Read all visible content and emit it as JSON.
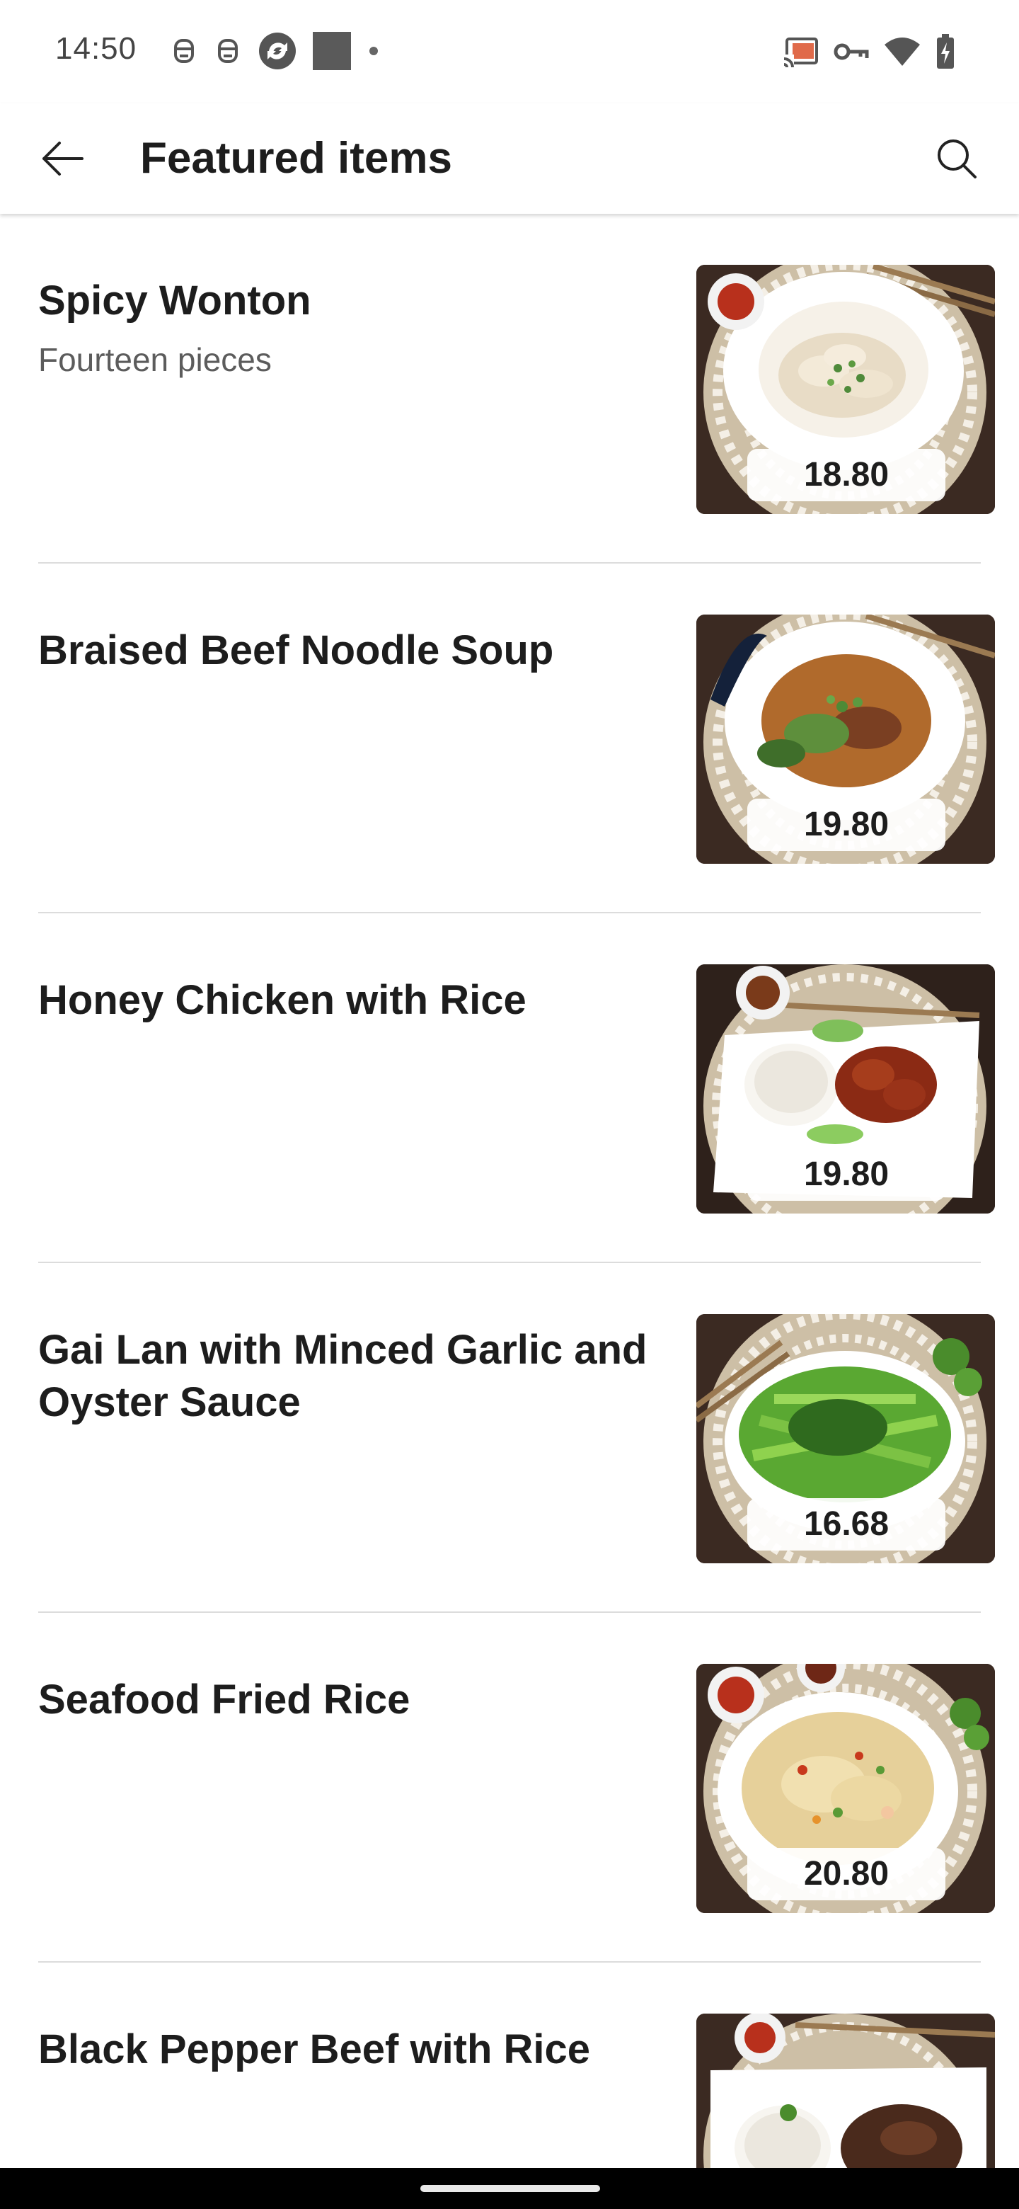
{
  "status_bar": {
    "time": "14:50",
    "left_icons": [
      "notification-icon",
      "notification-icon",
      "sync-icon",
      "square-icon",
      "dot-icon"
    ],
    "right_icons": [
      "cast-icon",
      "vpn-key-icon",
      "wifi-icon",
      "battery-charging-icon"
    ]
  },
  "app_bar": {
    "title": "Featured items",
    "back_icon": "arrow-left-icon",
    "search_icon": "search-icon"
  },
  "items": [
    {
      "name": "Spicy Wonton",
      "description": "Fourteen pieces",
      "price": "18.80"
    },
    {
      "name": "Braised Beef Noodle Soup",
      "description": "",
      "price": "19.80"
    },
    {
      "name": "Honey Chicken with Rice",
      "description": "",
      "price": "19.80"
    },
    {
      "name": "Gai Lan with Minced Garlic and Oyster Sauce",
      "description": "",
      "price": "16.68"
    },
    {
      "name": "Seafood Fried Rice",
      "description": "",
      "price": "20.80"
    },
    {
      "name": "Black Pepper Beef with Rice",
      "description": "",
      "price": ""
    }
  ],
  "colors": {
    "background": "#ffffff",
    "text_primary": "#1d1d1d",
    "text_secondary": "#5c5c5c",
    "divider": "#dcdcdc",
    "photo_background": "#2d2420",
    "nav_bar": "#000000"
  }
}
